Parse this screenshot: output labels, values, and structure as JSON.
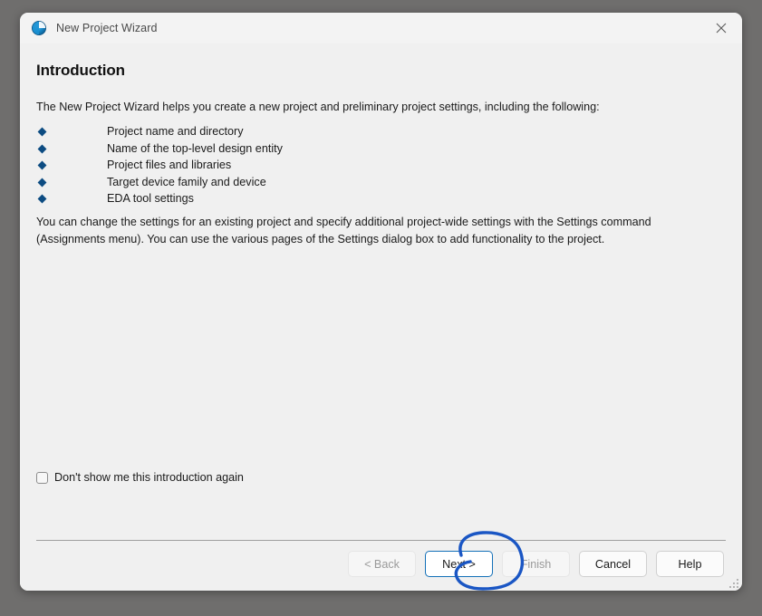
{
  "window": {
    "title": "New Project Wizard",
    "icon": "quartus-globe-icon",
    "close_icon": "close-icon"
  },
  "page": {
    "heading": "Introduction",
    "intro": "The New Project Wizard helps you create a new project and preliminary project settings, including the following:",
    "bullets": [
      {
        "label": "Project name and directory"
      },
      {
        "label": "Name of the top-level design entity"
      },
      {
        "label": "Project files and libraries"
      },
      {
        "label": "Target device family and device"
      },
      {
        "label": "EDA tool settings"
      }
    ],
    "body": "You can change the settings for an existing project and specify additional project-wide settings with the Settings command (Assignments menu). You can use the various pages of the Settings dialog box to add functionality to the project."
  },
  "checkbox": {
    "label": "Don't show me this introduction again",
    "checked": false
  },
  "footer": {
    "buttons": [
      {
        "label": "< Back",
        "state": "disabled"
      },
      {
        "label": "Next >",
        "state": "default"
      },
      {
        "label": "Finish",
        "state": "disabled"
      },
      {
        "label": "Cancel",
        "state": "normal"
      },
      {
        "label": "Help",
        "state": "normal"
      }
    ]
  },
  "annotation": {
    "type": "hand-drawn-circle",
    "target": "Next >",
    "color": "#1a56c4"
  },
  "colors": {
    "desktop": "#6f6e6d",
    "window": "#f0f0f0",
    "titlebar": "#f3f3f3",
    "bullet": "#0d4c82",
    "accent": "#1470b8",
    "annotation": "#1a56c4"
  }
}
